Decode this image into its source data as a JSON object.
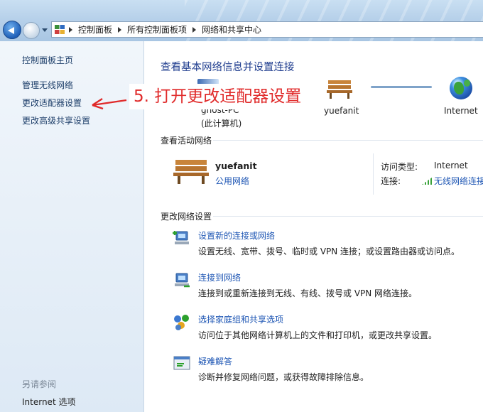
{
  "breadcrumb": [
    "控制面板",
    "所有控制面板项",
    "网络和共享中心"
  ],
  "sidebar": {
    "home": "控制面板主页",
    "items": [
      "管理无线网络",
      "更改适配器设置",
      "更改高级共享设置"
    ],
    "see_also_title": "另请参阅",
    "see_also_items": [
      "Internet 选项"
    ]
  },
  "annotation": "5. 打开更改适配器设置",
  "main": {
    "title": "查看基本网络信息并设置连接",
    "map": {
      "computer_name": "gnost-PC",
      "computer_sub": "(此计算机)",
      "network": "yuefanit",
      "internet": "Internet"
    },
    "active_label": "查看活动网络",
    "active_network": {
      "name": "yuefanit",
      "type": "公用网络",
      "access_label": "访问类型:",
      "access_value": "Internet",
      "conn_label": "连接:",
      "conn_value": "无线网络连接"
    },
    "change_label": "更改网络设置",
    "tasks": [
      {
        "link": "设置新的连接或网络",
        "desc": "设置无线、宽带、拨号、临时或 VPN 连接；或设置路由器或访问点。"
      },
      {
        "link": "连接到网络",
        "desc": "连接到或重新连接到无线、有线、拨号或 VPN 网络连接。"
      },
      {
        "link": "选择家庭组和共享选项",
        "desc": "访问位于其他网络计算机上的文件和打印机，或更改共享设置。"
      },
      {
        "link": "疑难解答",
        "desc": "诊断并修复网络问题，或获得故障排除信息。"
      }
    ]
  },
  "colors": {
    "link": "#1e56b4",
    "title": "#1e3c8e",
    "annotation": "#e02a2a"
  }
}
